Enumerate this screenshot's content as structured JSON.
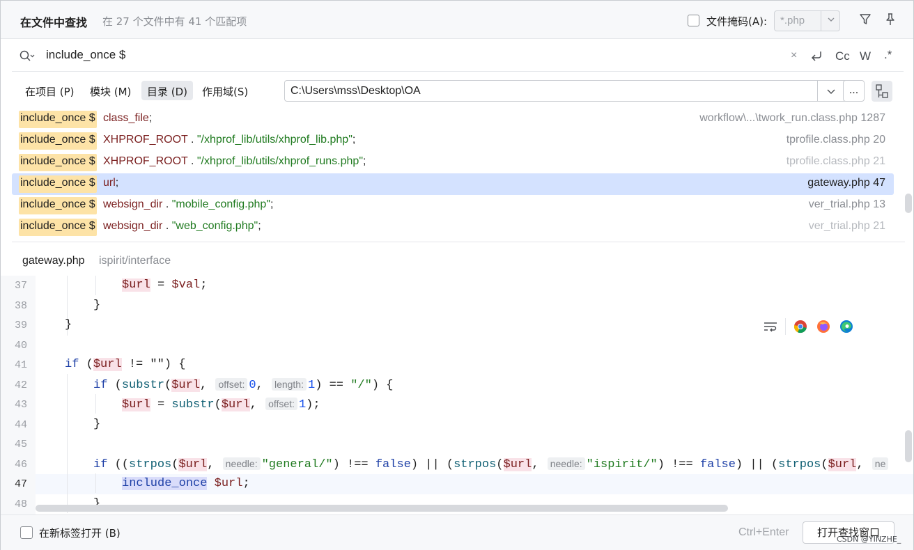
{
  "header": {
    "title": "在文件中查找",
    "summary": "在 27 个文件中有 41 个匹配项",
    "file_mask_label": "文件掩码(A):",
    "file_mask_value": "*.php"
  },
  "search": {
    "query": "include_once $",
    "clear": "×",
    "match_case": "Cc",
    "words": "W",
    "regex": ".*"
  },
  "scope": {
    "tabs": [
      {
        "label": "在项目 (P)"
      },
      {
        "label": "模块 (M)"
      },
      {
        "label": "目录 (D)"
      },
      {
        "label": "作用域(S)"
      }
    ],
    "directory": "C:\\Users\\mss\\Desktop\\OA",
    "browse": "..."
  },
  "results": [
    {
      "match": "include_once $",
      "rest_var": "class_file",
      "rest_tail": ";",
      "rest_str": "",
      "rest_end": "",
      "file": "workflow\\...\\twork_run.class.php 1287"
    },
    {
      "match": "include_once $",
      "rest_var": "XHPROF_ROOT",
      "rest_tail": " . ",
      "rest_str": "\"/xhprof_lib/utils/xhprof_lib.php\"",
      "rest_end": ";",
      "file": "tprofile.class.php 20"
    },
    {
      "match": "include_once $",
      "rest_var": "XHPROF_ROOT",
      "rest_tail": " . ",
      "rest_str": "\"/xhprof_lib/utils/xhprof_runs.php\"",
      "rest_end": ";",
      "file": "tprofile.class.php 21"
    },
    {
      "match": "include_once $",
      "rest_var": "url",
      "rest_tail": ";",
      "rest_str": "",
      "rest_end": "",
      "file": "gateway.php 47"
    },
    {
      "match": "include_once $",
      "rest_var": "websign_dir",
      "rest_tail": " . ",
      "rest_str": "\"mobile_config.php\"",
      "rest_end": ";",
      "file": "ver_trial.php 13"
    },
    {
      "match": "include_once $",
      "rest_var": "websign_dir",
      "rest_tail": " . ",
      "rest_str": "\"web_config.php\"",
      "rest_end": ";",
      "file": "ver_trial.php 21"
    }
  ],
  "preview": {
    "file": "gateway.php",
    "path": "ispirit/interface",
    "line_numbers": [
      "37",
      "38",
      "39",
      "40",
      "41",
      "42",
      "43",
      "44",
      "45",
      "46",
      "47",
      "48"
    ],
    "current_line": "47",
    "hints": {
      "offset": "offset:",
      "length": "length:",
      "needle": "needle:"
    }
  },
  "code": {
    "l37_var": "$url",
    "l37_eq": " = ",
    "l37_val": "$val",
    "l37_end": ";",
    "brace_close": "}",
    "kw_if": "if",
    "l41_open": " (",
    "l41_var": "$url",
    "l41_rest": " != \"\") {",
    "l42_open": " (",
    "fn_substr": "substr",
    "fn_strpos": "strpos",
    "paren_open": "(",
    "l42_var": "$url",
    "comma": ", ",
    "n0": "0",
    "n1": "1",
    "l42_eq": ") == ",
    "l42_str": "\"/\"",
    "l42_end": ") {",
    "l43_var": "$url",
    "l43_eq": " = ",
    "l43_end": ");",
    "l46_open": " ((",
    "l46_var": "$url",
    "l46_str1": "\"general/\"",
    "l46_mid": ") !== ",
    "kw_false": "false",
    "l46_or": ") || (",
    "l46_str2": "\"ispirit/\"",
    "l46_tail": ") || (",
    "l46_cut": "ne",
    "l47_inc": "include_once",
    "l47_var": "$url",
    "l47_end": ";"
  },
  "footer": {
    "new_tab_label": "在新标签打开 (B)",
    "shortcut": "Ctrl+Enter",
    "open_button": "打开查找窗口"
  },
  "watermark": "CSDN @YINZHE_"
}
